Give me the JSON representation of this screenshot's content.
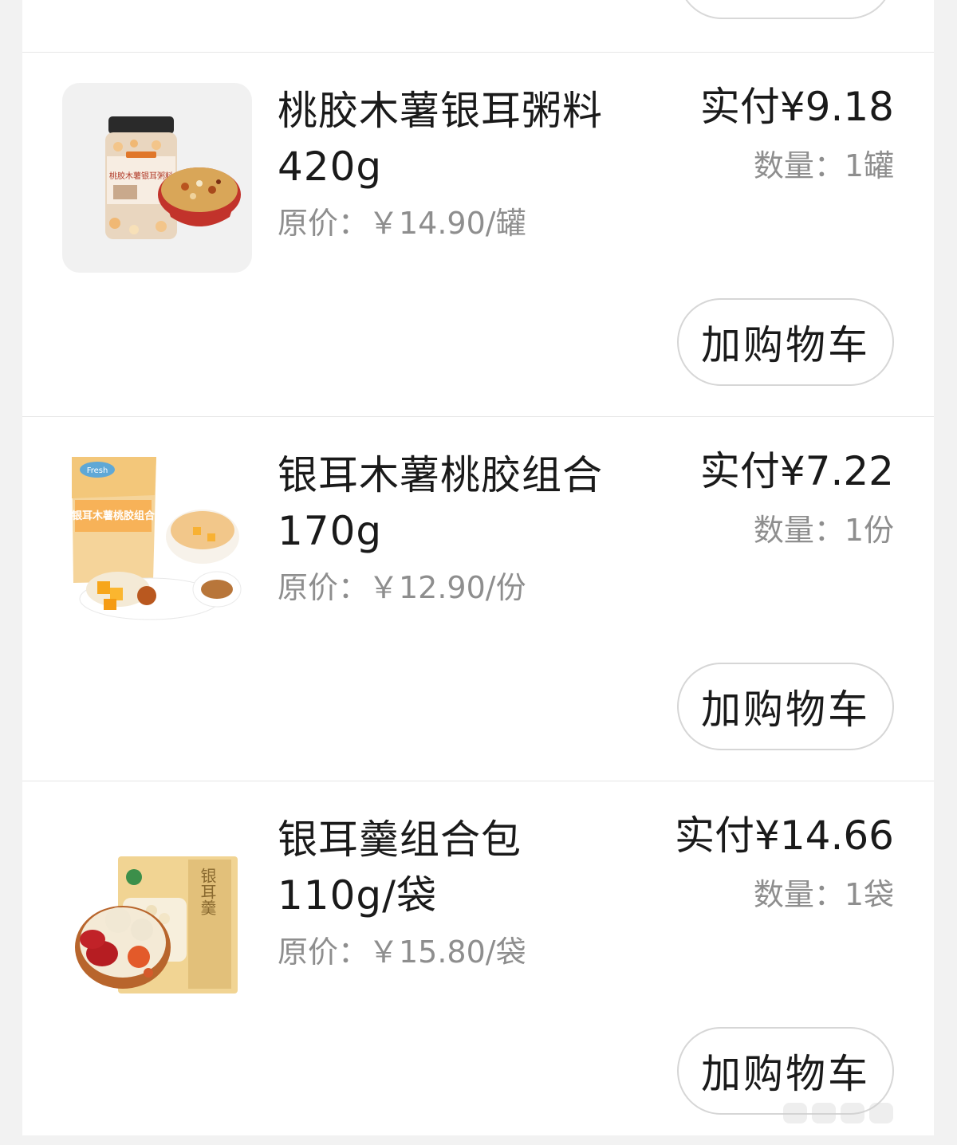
{
  "items": [
    {
      "name_line1": "桃胶木薯银耳粥料",
      "name_line2": "420g",
      "original_price": "原价：￥14.90/罐",
      "paid": "实付¥9.18",
      "quantity": "数量：1罐",
      "add_to_cart": "加购物车",
      "image_label": "桃胶木薯银耳粥料"
    },
    {
      "name_line1": "银耳木薯桃胶组合",
      "name_line2": "170g",
      "original_price": "原价：￥12.90/份",
      "paid": "实付¥7.22",
      "quantity": "数量：1份",
      "add_to_cart": "加购物车",
      "image_label": "银耳木薯桃胶组合",
      "image_brand": "Fresh"
    },
    {
      "name_line1": "银耳羹组合包",
      "name_line2": "110g/袋",
      "original_price": "原价：￥15.80/袋",
      "paid": "实付¥14.66",
      "quantity": "数量：1袋",
      "add_to_cart": "加购物车",
      "image_label": "银耳羹"
    }
  ]
}
